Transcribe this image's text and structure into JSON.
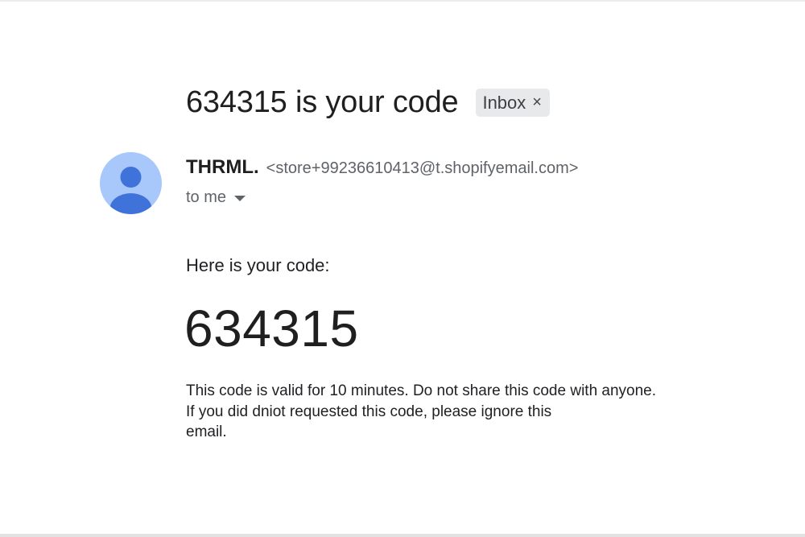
{
  "email": {
    "subject": "634315 is your code",
    "label": "Inbox",
    "label_close": "×",
    "sender_name": "THRML.",
    "sender_email": "<store+99236610413@t.shopifyemail.com>",
    "recipient": "to me"
  },
  "body": {
    "intro": "Here is your code:",
    "code": "634315",
    "notice_lines": [
      "This code is valid for 10 minutes. Do not share this code with anyone.",
      "If you did dniot requested this code, please ignore this",
      "email."
    ]
  },
  "colors": {
    "avatar_bg": "#a8c7fa",
    "avatar_figure": "#3f73d9",
    "chip_bg": "#e8e9eb"
  },
  "icons": {
    "avatar": "default-person-avatar-icon",
    "chip_close": "close-icon",
    "recipient_toggle": "caret-down-icon"
  }
}
